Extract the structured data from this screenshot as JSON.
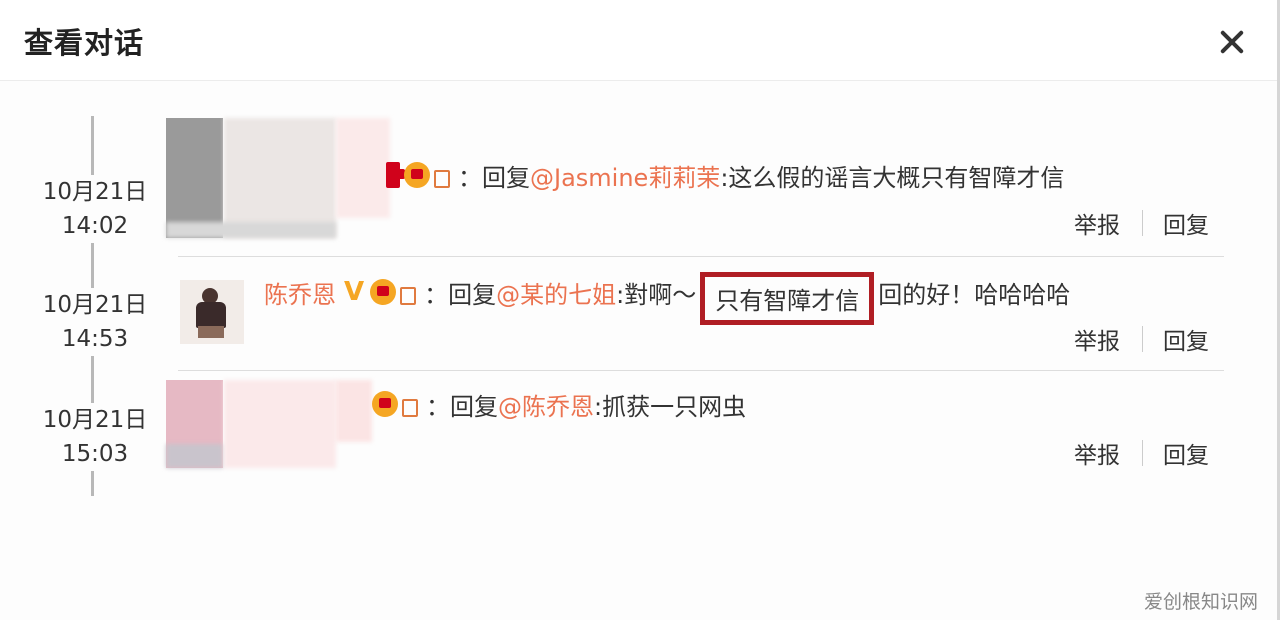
{
  "dialog": {
    "title": "查看对话",
    "close_icon": "close-icon"
  },
  "messages": [
    {
      "date": "10月21日",
      "time": "14:02",
      "text_prefix": "：回复",
      "mention": "@Jasmine莉莉茉",
      "text": ":这么假的谣言大概只有智障才信",
      "report_label": "举报",
      "reply_label": "回复"
    },
    {
      "date": "10月21日",
      "time": "14:53",
      "author": "陈乔恩",
      "verified_icon": "verified-v-icon",
      "text_prefix": "：回复",
      "mention": "@某的七姐",
      "text_before": ":對啊～",
      "highlighted": "只有智障才信",
      "text_after": "回的好！哈哈哈哈",
      "report_label": "举报",
      "reply_label": "回复"
    },
    {
      "date": "10月21日",
      "time": "15:03",
      "text_prefix": "：回复",
      "mention": "@陈乔恩",
      "text": ":抓获一只网虫",
      "report_label": "举报",
      "reply_label": "回复"
    }
  ],
  "watermark": "爱创根知识网",
  "colors": {
    "accent": "#eb7350",
    "highlight_box": "#b01e24",
    "badge": "#f5a623"
  }
}
